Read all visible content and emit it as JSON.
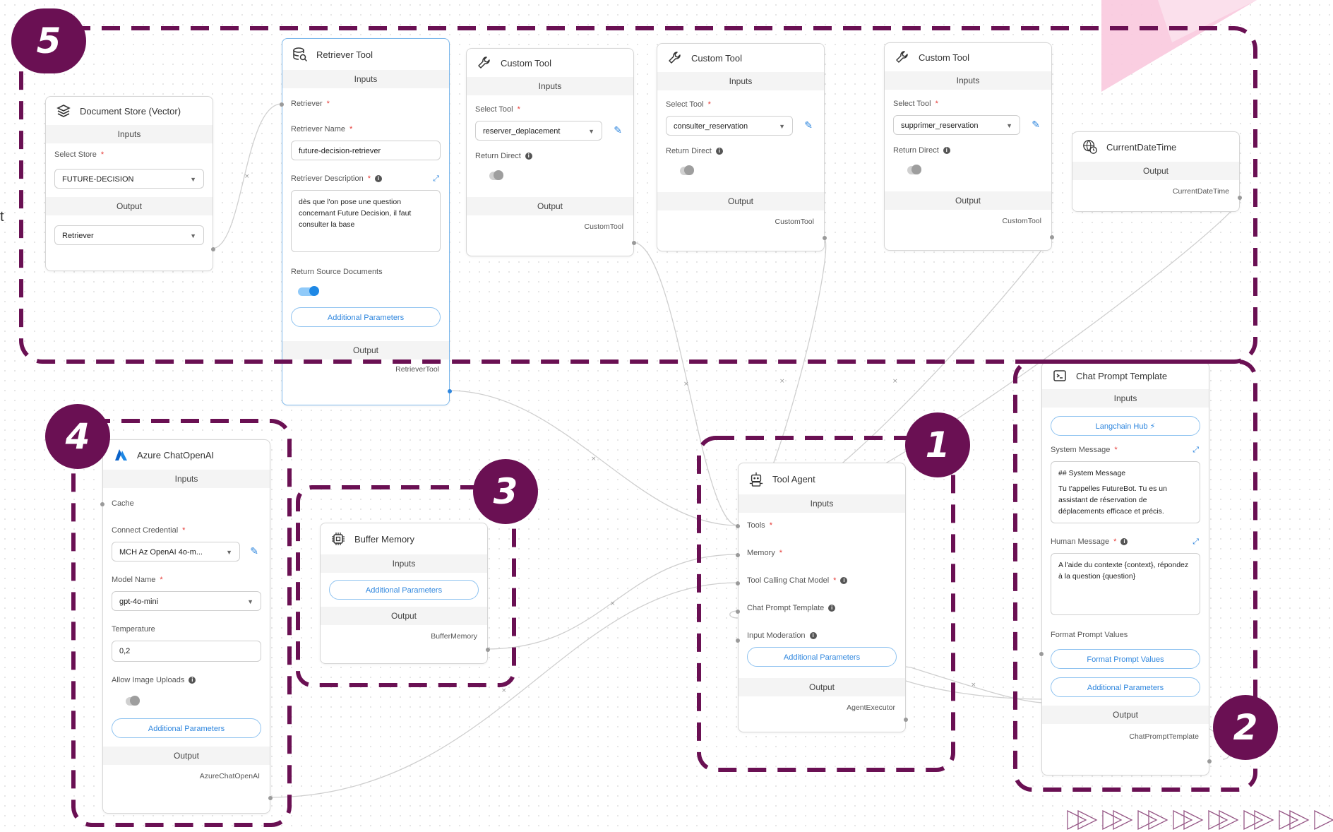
{
  "colors": {
    "frame": "#6a1053",
    "accent": "#2e86de",
    "edge": "#cfcfcf"
  },
  "left_cutoff": "t",
  "badges": [
    "5",
    "4",
    "3",
    "1",
    "2"
  ],
  "doc_store": {
    "title": "Document Store (Vector)",
    "icon": "layers-icon",
    "inputs": "Inputs",
    "select_store_label": "Select Store",
    "select_store_value": "FUTURE-DECISION",
    "output": "Output",
    "output_value": "Retriever"
  },
  "retriever_tool": {
    "title": "Retriever Tool",
    "icon": "database-search-icon",
    "inputs": "Inputs",
    "retriever_label": "Retriever",
    "name_label": "Retriever Name",
    "name_value": "future-decision-retriever",
    "desc_label": "Retriever Description",
    "desc_value": "dès que l'on pose une question concernant Future Decision, il faut consulter la base",
    "return_source_label": "Return Source Documents",
    "additional": "Additional Parameters",
    "output": "Output",
    "output_value": "RetrieverTool"
  },
  "custom_tools": [
    {
      "title": "Custom Tool",
      "inputs": "Inputs",
      "select_label": "Select Tool",
      "select_value": "reserver_deplacement",
      "return_direct": "Return Direct",
      "output": "Output",
      "output_value": "CustomTool"
    },
    {
      "title": "Custom Tool",
      "inputs": "Inputs",
      "select_label": "Select Tool",
      "select_value": "consulter_reservation",
      "return_direct": "Return Direct",
      "output": "Output",
      "output_value": "CustomTool"
    },
    {
      "title": "Custom Tool",
      "inputs": "Inputs",
      "select_label": "Select Tool",
      "select_value": "supprimer_reservation",
      "return_direct": "Return Direct",
      "output": "Output",
      "output_value": "CustomTool"
    }
  ],
  "current_datetime": {
    "title": "CurrentDateTime",
    "output": "Output",
    "output_value": "CurrentDateTime"
  },
  "azure": {
    "title": "Azure ChatOpenAI",
    "inputs": "Inputs",
    "cache_label": "Cache",
    "credential_label": "Connect Credential",
    "credential_value": "MCH Az OpenAI 4o-m...",
    "model_label": "Model Name",
    "model_value": "gpt-4o-mini",
    "temperature_label": "Temperature",
    "temperature_value": "0,2",
    "image_uploads_label": "Allow Image Uploads",
    "additional": "Additional Parameters",
    "output": "Output",
    "output_value": "AzureChatOpenAI"
  },
  "buffer_memory": {
    "title": "Buffer Memory",
    "inputs": "Inputs",
    "additional": "Additional Parameters",
    "output": "Output",
    "output_value": "BufferMemory"
  },
  "tool_agent": {
    "title": "Tool Agent",
    "inputs": "Inputs",
    "tools_label": "Tools",
    "memory_label": "Memory",
    "model_label": "Tool Calling Chat Model",
    "prompt_label": "Chat Prompt Template",
    "moderation_label": "Input Moderation",
    "additional": "Additional Parameters",
    "output": "Output",
    "output_value": "AgentExecutor"
  },
  "chat_prompt": {
    "title": "Chat Prompt Template",
    "inputs": "Inputs",
    "hub_button": "Langchain Hub",
    "system_label": "System Message",
    "system_line1": "## System Message",
    "system_line2": "Tu t'appelles FutureBot. Tu es un assistant de réservation de déplacements efficace et précis.",
    "human_label": "Human Message",
    "human_value": "A l'aide du contexte {context}, répondez à la question {question}",
    "format_label": "Format Prompt Values",
    "format_button": "Format Prompt Values",
    "additional": "Additional Parameters",
    "output": "Output",
    "output_value": "ChatPromptTemplate"
  }
}
